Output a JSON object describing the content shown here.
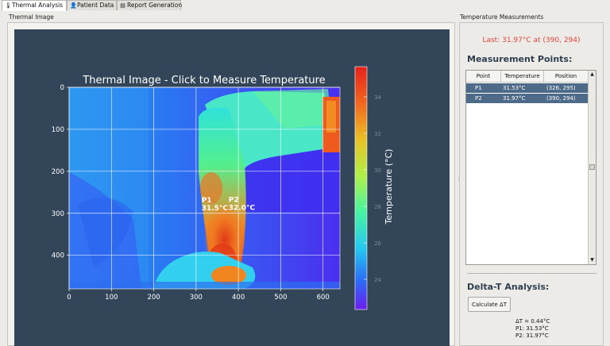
{
  "tabs": [
    {
      "label": "Thermal Analysis",
      "icon": "thermometer-icon",
      "active": true
    },
    {
      "label": "Patient Data",
      "icon": "person-icon",
      "active": false
    },
    {
      "label": "Report Generation",
      "icon": "document-icon",
      "active": false
    }
  ],
  "thermal": {
    "section_label": "Thermal Image",
    "plot_title": "Thermal Image - Click to Measure Temperature",
    "x_ticks": [
      "0",
      "100",
      "200",
      "300",
      "400",
      "500",
      "600"
    ],
    "y_ticks": [
      "0",
      "100",
      "200",
      "300",
      "400"
    ],
    "colorbar_label": "Temperature (°C)",
    "colorbar_ticks": [
      "34",
      "32",
      "30",
      "28",
      "26",
      "24"
    ],
    "markers": [
      {
        "name": "P1",
        "value_label": "31.5°C",
        "x": 326,
        "y": 295
      },
      {
        "name": "P2",
        "value_label": "32.0°C",
        "x": 390,
        "y": 294
      }
    ],
    "colors": {
      "background": "#334659",
      "cold": "#3b1fe8",
      "hot": "#e32a16"
    }
  },
  "measurements": {
    "section_label": "Temperature Measurements",
    "last": "Last: 31.97°C at (390, 294)",
    "points_title": "Measurement Points:",
    "columns": [
      "Point",
      "Temperature",
      "Position"
    ],
    "rows": [
      {
        "point": "P1",
        "temperature": "31.53°C",
        "position": "(326, 295)"
      },
      {
        "point": "P2",
        "temperature": "31.97°C",
        "position": "(390, 294)"
      }
    ]
  },
  "delta": {
    "title": "Delta-T Analysis:",
    "button_label": "Calculate ΔT",
    "lines": [
      "ΔT = 0.44°C",
      "P1: 31.53°C",
      "P2: 31.97°C"
    ]
  }
}
